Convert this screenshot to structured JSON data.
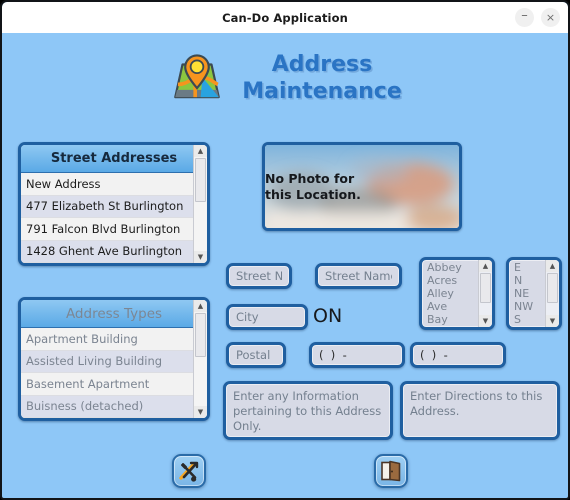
{
  "window": {
    "title": "Can-Do Application",
    "minimize_label": "–",
    "close_label": "×"
  },
  "header": {
    "title_line1": "Address",
    "title_line2": "Maintenance",
    "logo_icon": "map-location-pin-icon",
    "title_color": "#2a74c4"
  },
  "street_addresses": {
    "header": "Street Addresses",
    "items": [
      "New Address",
      "477 Elizabeth St Burlington",
      "791 Falcon Blvd Burlington",
      "1428 Ghent Ave Burlington"
    ]
  },
  "address_types": {
    "header": "Address Types",
    "items": [
      "Apartment Building",
      "Assisted Living Building",
      "Basement Apartment",
      "Buisness (detached)"
    ]
  },
  "photo": {
    "line1": "No Photo for",
    "line2": "this Location."
  },
  "form": {
    "street_no_placeholder": "Street No",
    "street_name_placeholder": "Street Name",
    "city_placeholder": "City",
    "province": "ON",
    "postal_placeholder": "Postal",
    "phone1_value": "(  )  -",
    "phone2_value": "(  )  -",
    "info_placeholder": "Enter any Information pertaining to this Address Only.",
    "directions_placeholder": "Enter Directions to this Address."
  },
  "street_types": {
    "items": [
      "Abbey",
      "Acres",
      "Alley",
      "Ave",
      "Bay"
    ]
  },
  "directions": {
    "items": [
      "E",
      "N",
      "NE",
      "NW",
      "S"
    ]
  },
  "buttons": {
    "tools_icon": "tools-wrench-hammer-icon",
    "exit_icon": "exit-door-icon"
  },
  "colors": {
    "background": "#8ec7f7",
    "frame_border": "#1f5fa0",
    "field_fill": "#d7dae6",
    "header_gradient_top": "#8fc8f2",
    "header_gradient_bottom": "#5aa9e6"
  }
}
